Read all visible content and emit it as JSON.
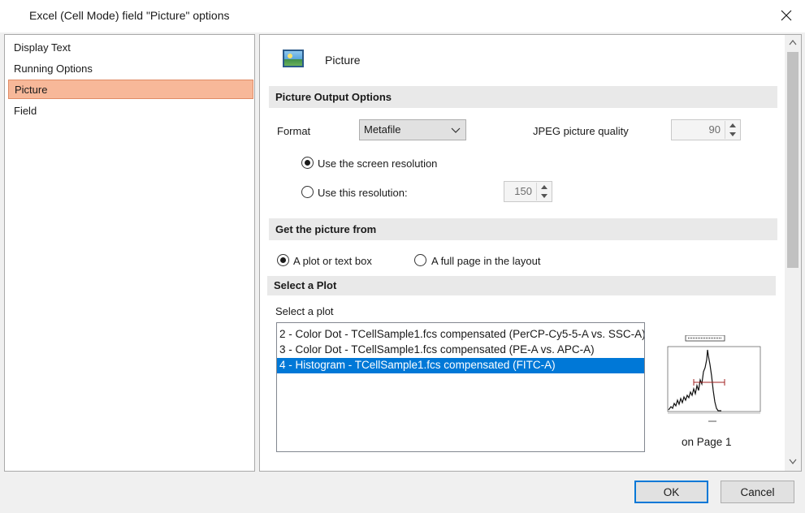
{
  "window": {
    "title": "Excel (Cell Mode) field \"Picture\" options"
  },
  "nav": {
    "items": [
      {
        "label": "Display Text"
      },
      {
        "label": "Running Options"
      },
      {
        "label": "Picture"
      },
      {
        "label": "Field"
      }
    ],
    "selected": "Picture"
  },
  "panel": {
    "title": "Picture",
    "output_section": "Picture Output Options",
    "format_label": "Format",
    "format_value": "Metafile",
    "jpeg_quality_label": "JPEG picture quality",
    "jpeg_quality_value": "90",
    "screen_resolution_label": "Use the screen resolution",
    "this_resolution_label": "Use this resolution:",
    "resolution_value": "150",
    "source_section": "Get the picture from",
    "plot_or_textbox_label": "A plot or text box",
    "full_page_label": "A full page in the layout",
    "select_plot_section": "Select a Plot",
    "select_plot_label": "Select a plot",
    "plots": [
      "2 - Color Dot - TCellSample1.fcs compensated (PerCP-Cy5-5-A vs. SSC-A)",
      "3 - Color Dot - TCellSample1.fcs compensated (PE-A vs. APC-A)",
      "4 - Histogram - TCellSample1.fcs compensated (FITC-A)"
    ],
    "selected_plot_index": 2,
    "page_caption": "on Page 1"
  },
  "buttons": {
    "ok": "OK",
    "cancel": "Cancel"
  },
  "colors": {
    "selected_nav": "#f7b899",
    "selected_row": "#0078d7",
    "default_button_border": "#0078d7"
  }
}
